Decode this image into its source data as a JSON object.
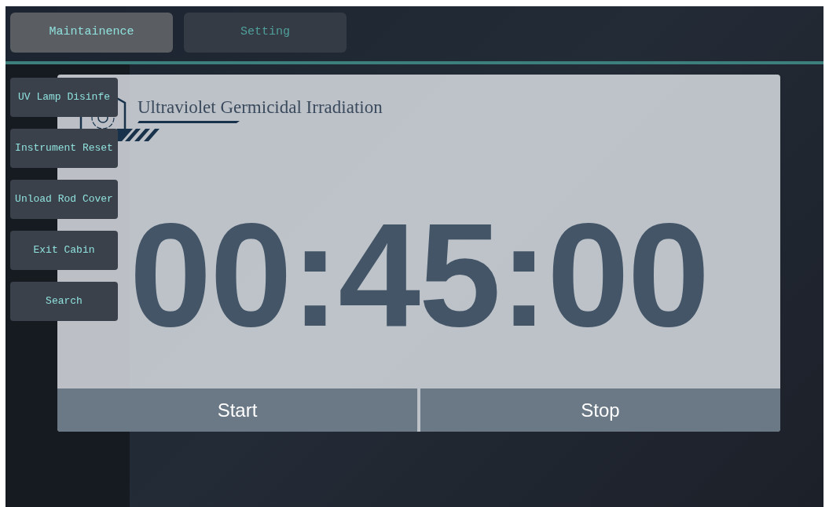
{
  "tabs": [
    {
      "label": "Maintainence",
      "selected": true
    },
    {
      "label": "Setting",
      "selected": false
    }
  ],
  "sidebar": {
    "items": [
      {
        "label": "UV Lamp Disinfe"
      },
      {
        "label": "Instrument Reset"
      },
      {
        "label": "Unload Rod Cover"
      },
      {
        "label": "Exit Cabin"
      },
      {
        "label": "Search"
      }
    ]
  },
  "dialog": {
    "title": "Ultraviolet Germicidal Irradiation",
    "timer": "00:45:00",
    "buttons": [
      "Start",
      "Stop"
    ]
  }
}
